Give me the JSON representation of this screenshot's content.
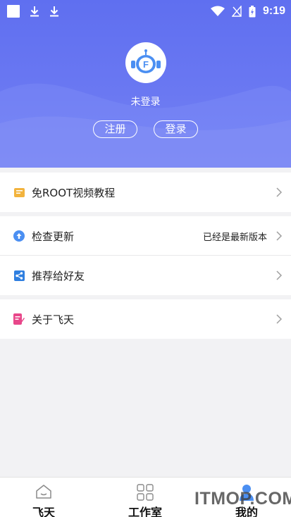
{
  "status_bar": {
    "time": "9:19"
  },
  "profile": {
    "login_status": "未登录",
    "register_label": "注册",
    "login_label": "登录"
  },
  "menu": {
    "tutorial": {
      "label": "免ROOT视频教程",
      "icon": "book-icon"
    },
    "check_update": {
      "label": "检查更新",
      "status": "已经是最新版本",
      "icon": "upload-icon"
    },
    "share": {
      "label": "推荐给好友",
      "icon": "share-icon"
    },
    "about": {
      "label": "关于飞天",
      "icon": "note-icon"
    }
  },
  "tabbar": {
    "tabs": [
      {
        "label": "飞天",
        "icon": "home-icon"
      },
      {
        "label": "工作室",
        "icon": "grid-icon"
      },
      {
        "label": "我的",
        "icon": "person-icon",
        "active": true
      }
    ]
  },
  "watermark": "ITMOP.COM",
  "colors": {
    "header": "#6272f0",
    "accent": "#5a8ef0",
    "background": "#f2f2f4"
  }
}
